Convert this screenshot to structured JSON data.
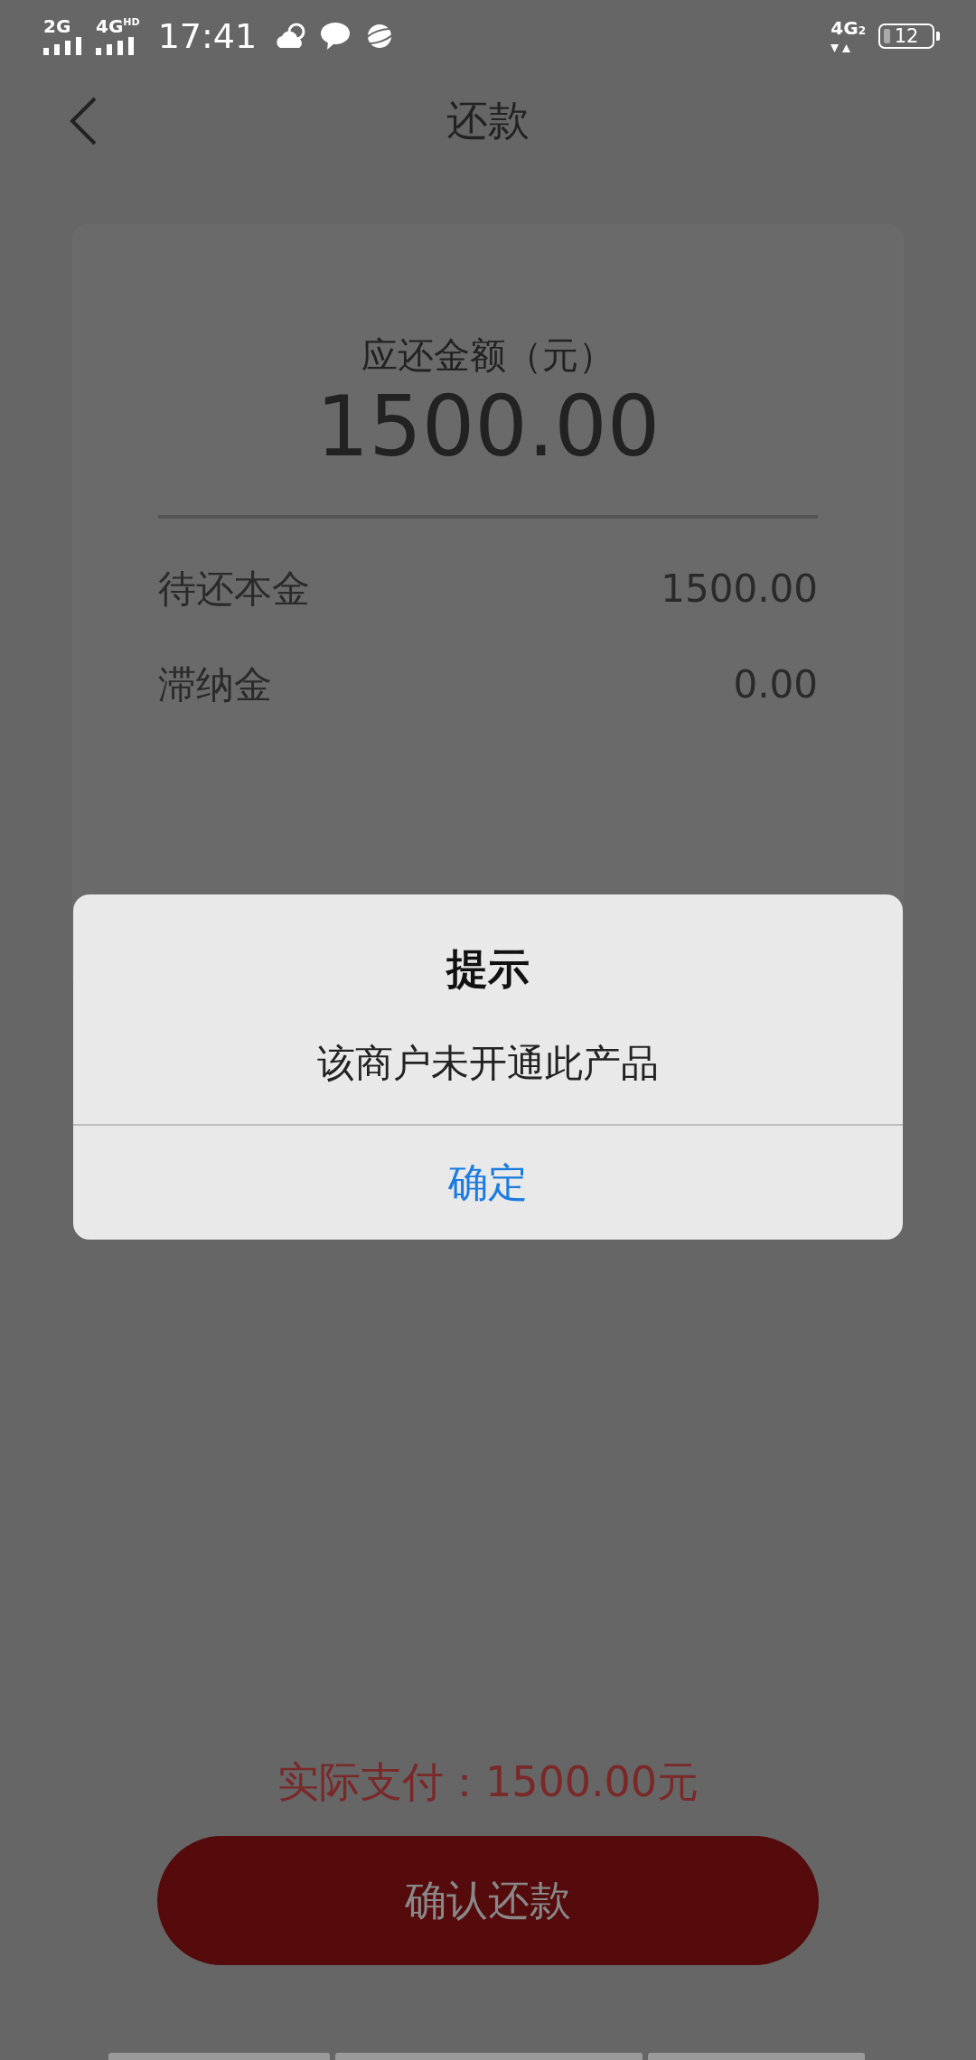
{
  "status_bar": {
    "sim1": "2G",
    "sim2": "4G",
    "sim2_badge": "HD",
    "time": "17:41",
    "network": "4G",
    "network_sub": "2",
    "battery": "12"
  },
  "header": {
    "title": "还款"
  },
  "summary": {
    "label": "应还金额（元）",
    "amount": "1500.00",
    "rows": [
      {
        "label": "待还本金",
        "value": "1500.00"
      },
      {
        "label": "滞纳金",
        "value": "0.00"
      }
    ]
  },
  "footer": {
    "total": "实际支付：1500.00元",
    "button": "确认还款"
  },
  "dialog": {
    "title": "提示",
    "message": "该商户未开通此产品",
    "button": "确定"
  }
}
